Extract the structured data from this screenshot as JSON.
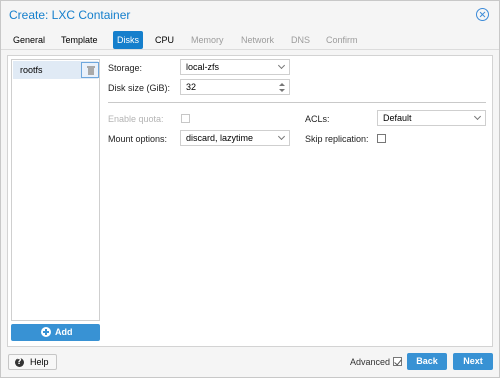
{
  "window": {
    "title": "Create: LXC Container",
    "close_icon": "close-circle-icon"
  },
  "tabs": [
    {
      "label": "General",
      "state": "normal"
    },
    {
      "label": "Template",
      "state": "normal"
    },
    {
      "label": "Disks",
      "state": "active"
    },
    {
      "label": "CPU",
      "state": "normal"
    },
    {
      "label": "Memory",
      "state": "disabled"
    },
    {
      "label": "Network",
      "state": "disabled"
    },
    {
      "label": "DNS",
      "state": "disabled"
    },
    {
      "label": "Confirm",
      "state": "disabled"
    }
  ],
  "disk_list": {
    "items": [
      {
        "label": "rootfs",
        "delete_icon": "trash-icon"
      }
    ],
    "add_label": "Add",
    "add_icon": "plus-circle-icon"
  },
  "form": {
    "storage": {
      "label": "Storage:",
      "value": "local-zfs"
    },
    "disk_size": {
      "label": "Disk size (GiB):",
      "value": "32"
    },
    "enable_quota": {
      "label": "Enable quota:",
      "checked": false,
      "disabled": true
    },
    "acls": {
      "label": "ACLs:",
      "value": "Default"
    },
    "mount_options": {
      "label": "Mount options:",
      "value": "discard, lazytime"
    },
    "skip_replication": {
      "label": "Skip replication:",
      "checked": false
    }
  },
  "footer": {
    "help_label": "Help",
    "help_icon": "question-circle-icon",
    "advanced_label": "Advanced",
    "advanced_checked": true,
    "back_label": "Back",
    "next_label": "Next"
  },
  "colors": {
    "accent": "#157fcc",
    "button": "#3892d4"
  }
}
